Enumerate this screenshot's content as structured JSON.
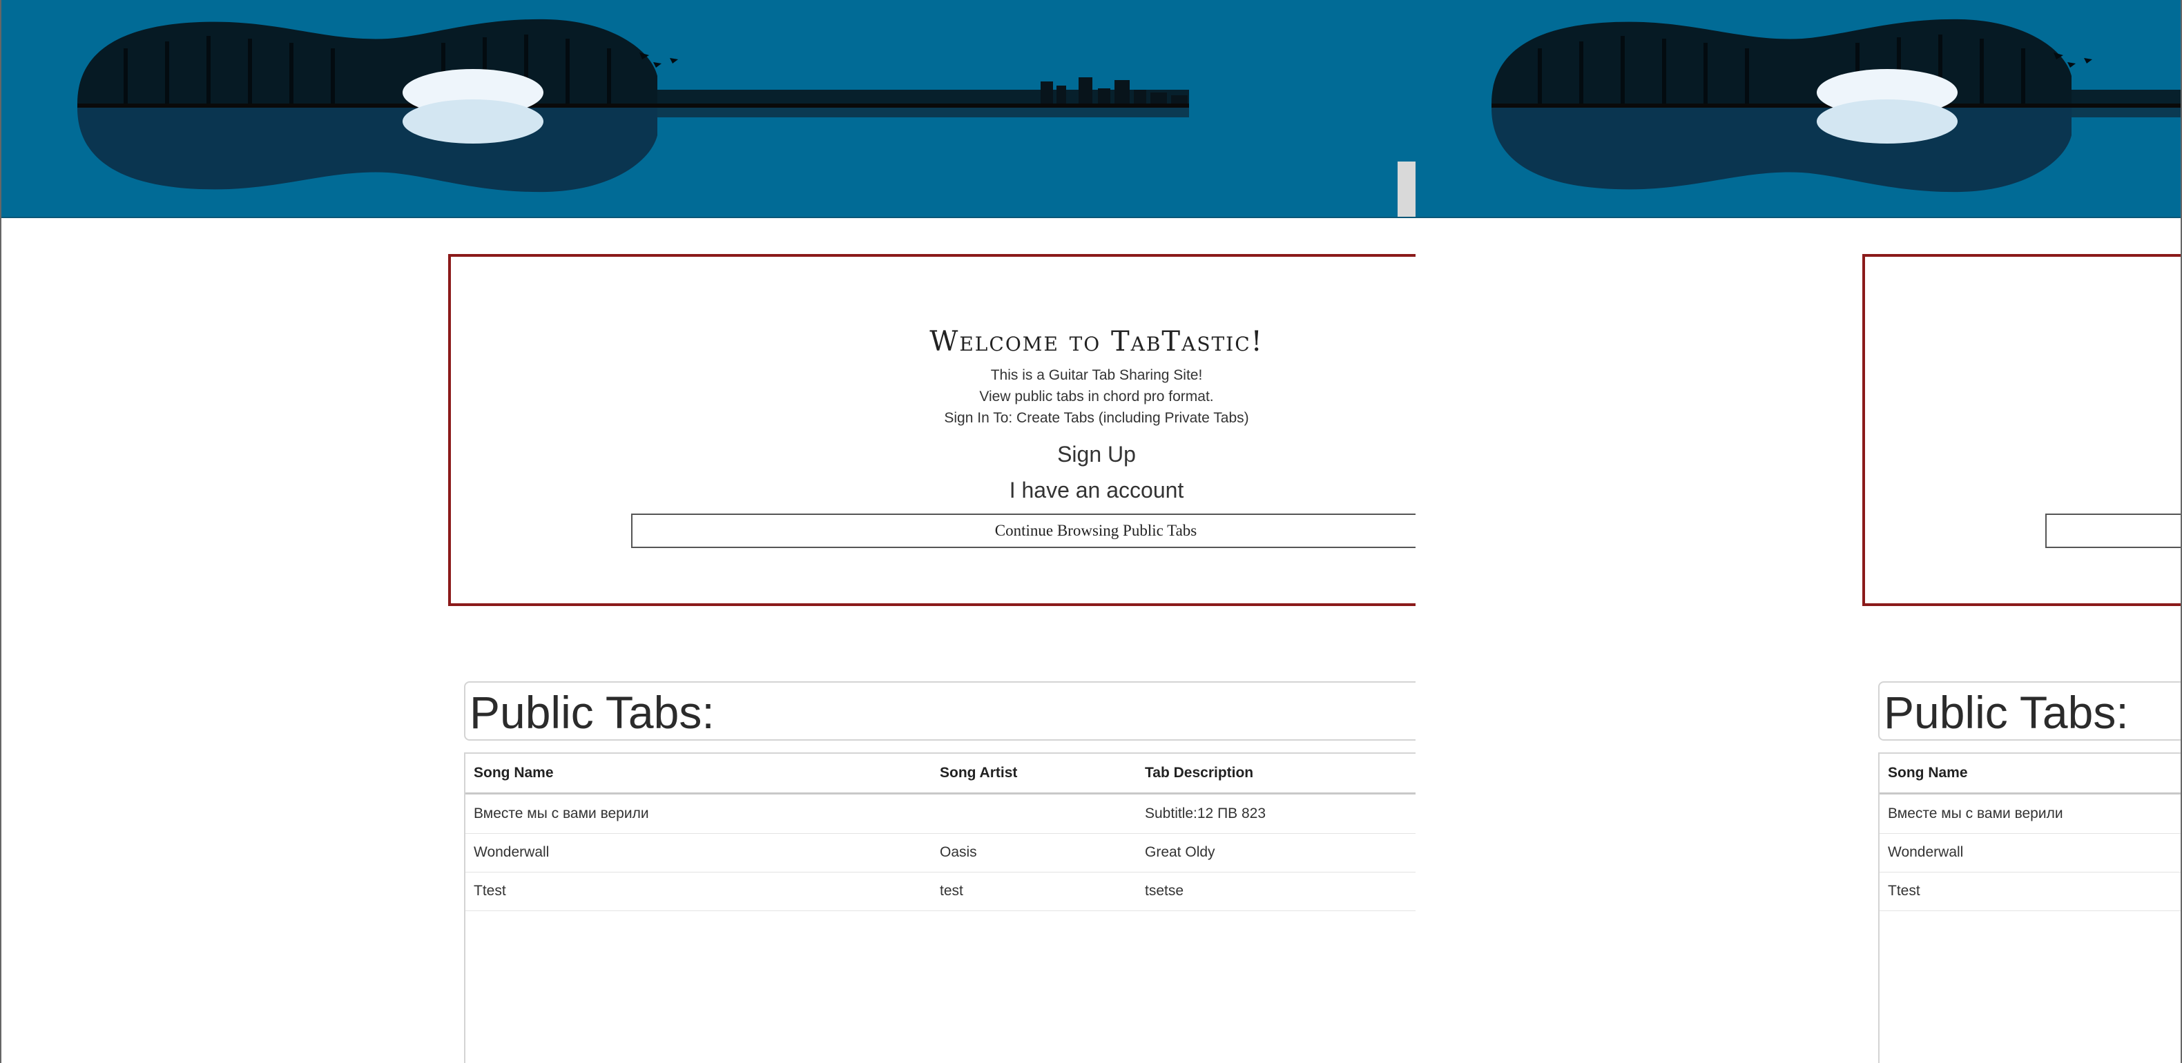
{
  "welcome": {
    "title": "Welcome to TabTastic!",
    "line1": "This is a Guitar Tab Sharing Site!",
    "line2": "View public tabs in chord pro format.",
    "line3": "Sign In To: Create Tabs (including Private Tabs)",
    "signup_label": "Sign Up",
    "login_label": "I have an account",
    "continue_label": "Continue Browsing Public Tabs"
  },
  "public_tabs": {
    "heading": "Public Tabs:",
    "columns": [
      "Song Name",
      "Song Artist",
      "Tab Description"
    ],
    "rows": [
      [
        "Вместе мы с вами верили",
        "",
        "Subtitle:12 ПВ 823"
      ],
      [
        "Wonderwall",
        "Oasis",
        "Great Oldy"
      ],
      [
        "Ttest",
        "test",
        "tsetse"
      ]
    ]
  },
  "colors": {
    "banner": "#016b96",
    "welcome_border": "#8b1a1a"
  }
}
